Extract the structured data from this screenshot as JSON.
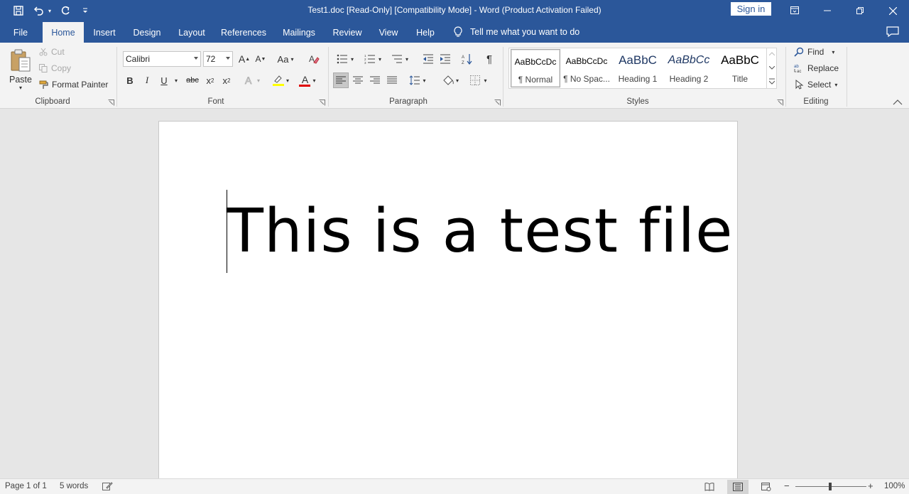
{
  "titlebar": {
    "title": "Test1.doc [Read-Only] [Compatibility Mode]  -  Word (Product Activation Failed)",
    "signin": "Sign in",
    "bg": "#2b579a"
  },
  "tabs": [
    {
      "label": "File"
    },
    {
      "label": "Home"
    },
    {
      "label": "Insert"
    },
    {
      "label": "Design"
    },
    {
      "label": "Layout"
    },
    {
      "label": "References"
    },
    {
      "label": "Mailings"
    },
    {
      "label": "Review"
    },
    {
      "label": "View"
    },
    {
      "label": "Help"
    }
  ],
  "tellme": "Tell me what you want to do",
  "clipboard": {
    "paste": "Paste",
    "cut": "Cut",
    "copy": "Copy",
    "format_painter": "Format Painter",
    "label": "Clipboard"
  },
  "font": {
    "name": "Calibri",
    "size": "72",
    "label": "Font",
    "grow": "A",
    "shrink": "A",
    "case": "Aa",
    "bold": "B",
    "italic": "I",
    "underline": "U",
    "strike": "abc",
    "sub": "x",
    "sup": "x",
    "color_letter": "A",
    "font_color": "#e00000",
    "highlight_color": "#ffff00"
  },
  "paragraph": {
    "label": "Paragraph",
    "pilcrow": "¶"
  },
  "styles": {
    "label": "Styles",
    "items": [
      {
        "preview": "AaBbCcDc",
        "name": "¶ Normal"
      },
      {
        "preview": "AaBbCcDc",
        "name": "¶ No Spac..."
      },
      {
        "preview": "AaBbC",
        "name": "Heading 1"
      },
      {
        "preview": "AaBbCc",
        "name": "Heading 2"
      },
      {
        "preview": "AaBbC",
        "name": "Title"
      }
    ]
  },
  "editing": {
    "label": "Editing",
    "find": "Find",
    "replace": "Replace",
    "select": "Select"
  },
  "document": {
    "text": "This is a test file"
  },
  "status": {
    "page": "Page 1 of 1",
    "words": "5 words",
    "zoom": "100%",
    "zoom_level_percent": 100
  }
}
